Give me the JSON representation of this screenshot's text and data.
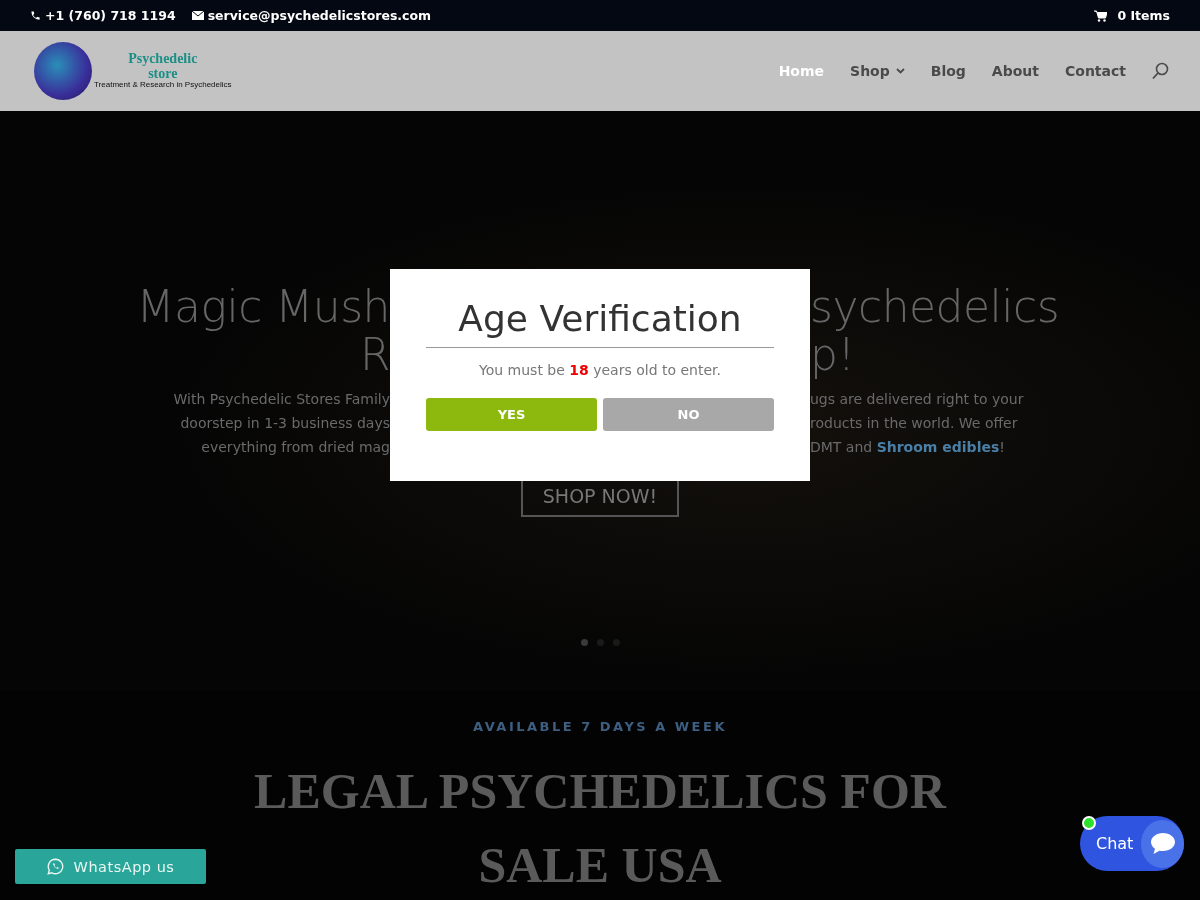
{
  "top_bar": {
    "phone": "+1 (760) 718 1194",
    "email": "service@psychedelicstores.com",
    "cart": "0 Items"
  },
  "header": {
    "logo": {
      "name_line_1": "Psychedelic",
      "name_line_2": "store",
      "tagline": "Treatment & Research in Psychedelics"
    },
    "nav": [
      {
        "label": "Home",
        "selected": true,
        "has_submenu": false
      },
      {
        "label": "Shop",
        "selected": false,
        "has_submenu": true
      },
      {
        "label": "Blog",
        "selected": false,
        "has_submenu": false
      },
      {
        "label": "About",
        "selected": false,
        "has_submenu": false
      },
      {
        "label": "Contact",
        "selected": false,
        "has_submenu": false
      }
    ]
  },
  "hero": {
    "title_lines": [
      {
        "left": "Magic Mush",
        "right": "sychedelics"
      },
      {
        "left": "R",
        "right": "p!"
      }
    ],
    "text_lines": [
      {
        "left": "With Psychedelic Stores Family",
        "right": "ugs are delivered right to your"
      },
      {
        "left": "doorstep in 1-3 business days",
        "right": "roducts in the world. We offer"
      },
      {
        "left": "everything from dried mag",
        "right": "DMT and **Shroom edibles**!"
      }
    ],
    "button": "SHOP NOW!",
    "slides": [
      {
        "selected": true
      },
      {
        "selected": false
      },
      {
        "selected": false
      }
    ]
  },
  "modal": {
    "title": "Age Verification",
    "message": "You must be **18** years old to enter.",
    "buttons": [
      {
        "label": "YES",
        "kind": "primary"
      },
      {
        "label": "NO",
        "kind": "secondary"
      }
    ]
  },
  "section": {
    "eyebrow": "AVAILABLE 7 DAYS A WEEK",
    "heading": "LEGAL PSYCHEDELICS FOR SALE USA"
  },
  "whatsapp": {
    "label": "WhatsApp us"
  },
  "chat": {
    "label": "Chat",
    "online": true
  }
}
